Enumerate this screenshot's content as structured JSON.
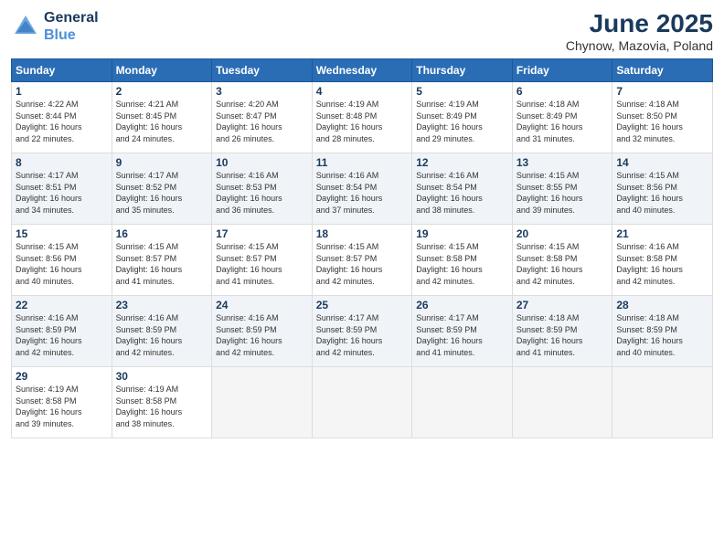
{
  "header": {
    "logo_line1": "General",
    "logo_line2": "Blue",
    "title": "June 2025",
    "subtitle": "Chynow, Mazovia, Poland"
  },
  "days_of_week": [
    "Sunday",
    "Monday",
    "Tuesday",
    "Wednesday",
    "Thursday",
    "Friday",
    "Saturday"
  ],
  "weeks": [
    [
      {
        "day": "1",
        "sunrise": "4:22 AM",
        "sunset": "8:44 PM",
        "daylight": "16 hours and 22 minutes."
      },
      {
        "day": "2",
        "sunrise": "4:21 AM",
        "sunset": "8:45 PM",
        "daylight": "16 hours and 24 minutes."
      },
      {
        "day": "3",
        "sunrise": "4:20 AM",
        "sunset": "8:47 PM",
        "daylight": "16 hours and 26 minutes."
      },
      {
        "day": "4",
        "sunrise": "4:19 AM",
        "sunset": "8:48 PM",
        "daylight": "16 hours and 28 minutes."
      },
      {
        "day": "5",
        "sunrise": "4:19 AM",
        "sunset": "8:49 PM",
        "daylight": "16 hours and 29 minutes."
      },
      {
        "day": "6",
        "sunrise": "4:18 AM",
        "sunset": "8:49 PM",
        "daylight": "16 hours and 31 minutes."
      },
      {
        "day": "7",
        "sunrise": "4:18 AM",
        "sunset": "8:50 PM",
        "daylight": "16 hours and 32 minutes."
      }
    ],
    [
      {
        "day": "8",
        "sunrise": "4:17 AM",
        "sunset": "8:51 PM",
        "daylight": "16 hours and 34 minutes."
      },
      {
        "day": "9",
        "sunrise": "4:17 AM",
        "sunset": "8:52 PM",
        "daylight": "16 hours and 35 minutes."
      },
      {
        "day": "10",
        "sunrise": "4:16 AM",
        "sunset": "8:53 PM",
        "daylight": "16 hours and 36 minutes."
      },
      {
        "day": "11",
        "sunrise": "4:16 AM",
        "sunset": "8:54 PM",
        "daylight": "16 hours and 37 minutes."
      },
      {
        "day": "12",
        "sunrise": "4:16 AM",
        "sunset": "8:54 PM",
        "daylight": "16 hours and 38 minutes."
      },
      {
        "day": "13",
        "sunrise": "4:15 AM",
        "sunset": "8:55 PM",
        "daylight": "16 hours and 39 minutes."
      },
      {
        "day": "14",
        "sunrise": "4:15 AM",
        "sunset": "8:56 PM",
        "daylight": "16 hours and 40 minutes."
      }
    ],
    [
      {
        "day": "15",
        "sunrise": "4:15 AM",
        "sunset": "8:56 PM",
        "daylight": "16 hours and 40 minutes."
      },
      {
        "day": "16",
        "sunrise": "4:15 AM",
        "sunset": "8:57 PM",
        "daylight": "16 hours and 41 minutes."
      },
      {
        "day": "17",
        "sunrise": "4:15 AM",
        "sunset": "8:57 PM",
        "daylight": "16 hours and 41 minutes."
      },
      {
        "day": "18",
        "sunrise": "4:15 AM",
        "sunset": "8:57 PM",
        "daylight": "16 hours and 42 minutes."
      },
      {
        "day": "19",
        "sunrise": "4:15 AM",
        "sunset": "8:58 PM",
        "daylight": "16 hours and 42 minutes."
      },
      {
        "day": "20",
        "sunrise": "4:15 AM",
        "sunset": "8:58 PM",
        "daylight": "16 hours and 42 minutes."
      },
      {
        "day": "21",
        "sunrise": "4:16 AM",
        "sunset": "8:58 PM",
        "daylight": "16 hours and 42 minutes."
      }
    ],
    [
      {
        "day": "22",
        "sunrise": "4:16 AM",
        "sunset": "8:59 PM",
        "daylight": "16 hours and 42 minutes."
      },
      {
        "day": "23",
        "sunrise": "4:16 AM",
        "sunset": "8:59 PM",
        "daylight": "16 hours and 42 minutes."
      },
      {
        "day": "24",
        "sunrise": "4:16 AM",
        "sunset": "8:59 PM",
        "daylight": "16 hours and 42 minutes."
      },
      {
        "day": "25",
        "sunrise": "4:17 AM",
        "sunset": "8:59 PM",
        "daylight": "16 hours and 42 minutes."
      },
      {
        "day": "26",
        "sunrise": "4:17 AM",
        "sunset": "8:59 PM",
        "daylight": "16 hours and 41 minutes."
      },
      {
        "day": "27",
        "sunrise": "4:18 AM",
        "sunset": "8:59 PM",
        "daylight": "16 hours and 41 minutes."
      },
      {
        "day": "28",
        "sunrise": "4:18 AM",
        "sunset": "8:59 PM",
        "daylight": "16 hours and 40 minutes."
      }
    ],
    [
      {
        "day": "29",
        "sunrise": "4:19 AM",
        "sunset": "8:58 PM",
        "daylight": "16 hours and 39 minutes."
      },
      {
        "day": "30",
        "sunrise": "4:19 AM",
        "sunset": "8:58 PM",
        "daylight": "16 hours and 38 minutes."
      },
      null,
      null,
      null,
      null,
      null
    ]
  ]
}
